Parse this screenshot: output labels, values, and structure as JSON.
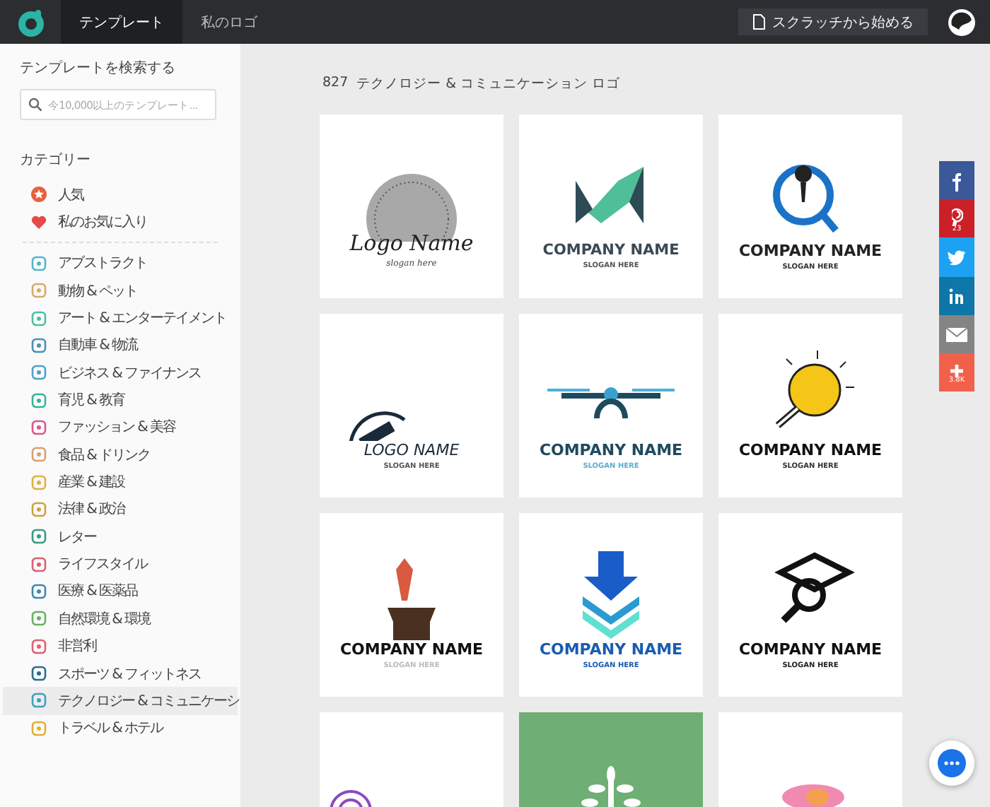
{
  "topbar": {
    "tabs": [
      {
        "label": "テンプレート",
        "selected": true
      },
      {
        "label": "私のロゴ",
        "selected": false
      }
    ],
    "start_button": "スクラッチから始める"
  },
  "sidebar": {
    "search_title": "テンプレートを検索する",
    "search": {
      "placeholder": "今10,000以上のテンプレート..."
    },
    "category_title": "カテゴリー",
    "pinned": [
      {
        "label": "人気",
        "kind": "star",
        "color": "#e8603c"
      },
      {
        "label": "私のお気に入り",
        "kind": "heart",
        "color": "#e84848"
      }
    ],
    "items": [
      {
        "label": "アブストラクト",
        "color": "#4fb8c9",
        "selected": false
      },
      {
        "label": "動物 & ペット",
        "color": "#d9a96a",
        "selected": false
      },
      {
        "label": "アート & エンターテイメント",
        "color": "#4fbfa0",
        "selected": false
      },
      {
        "label": "自動車 & 物流",
        "color": "#4a90b8",
        "selected": false
      },
      {
        "label": "ビジネス & ファイナンス",
        "color": "#4fa0c9",
        "selected": false
      },
      {
        "label": "育児 & 教育",
        "color": "#3ab09a",
        "selected": false
      },
      {
        "label": "ファッション & 美容",
        "color": "#d9588a",
        "selected": false
      },
      {
        "label": "食品 & ドリンク",
        "color": "#d9a070",
        "selected": false
      },
      {
        "label": "産業 & 建設",
        "color": "#e0b040",
        "selected": false
      },
      {
        "label": "法律 & 政治",
        "color": "#d0a040",
        "selected": false
      },
      {
        "label": "レター",
        "color": "#3a9a80",
        "selected": false
      },
      {
        "label": "ライフスタイル",
        "color": "#d96070",
        "selected": false
      },
      {
        "label": "医療 & 医薬品",
        "color": "#3a8ab0",
        "selected": false
      },
      {
        "label": "自然環境 & 環境",
        "color": "#6ab060",
        "selected": false
      },
      {
        "label": "非営利",
        "color": "#e06070",
        "selected": false
      },
      {
        "label": "スポーツ & フィットネス",
        "color": "#2a6a90",
        "selected": false
      },
      {
        "label": "テクノロジー & コミュニケーシ",
        "color": "#3aa0c0",
        "selected": true
      },
      {
        "label": "トラベル & ホテル",
        "color": "#e0b030",
        "selected": false
      }
    ]
  },
  "main": {
    "count": "827",
    "heading": "テクノロジー & コミュニケーション ロゴ",
    "tiles": [
      {
        "kind": "stamp",
        "name": "Logo Name",
        "slogan": "slogan here"
      },
      {
        "kind": "fold",
        "name": "COMPANY NAME",
        "slogan": "SLOGAN HERE"
      },
      {
        "kind": "search-person",
        "name": "COMPANY NAME",
        "slogan": "SLOGAN HERE"
      },
      {
        "kind": "satellite",
        "name": "LOGO NAME",
        "slogan": "SLOGAN HERE"
      },
      {
        "kind": "drone",
        "name": "COMPANY NAME",
        "slogan": "SLOGAN HERE"
      },
      {
        "kind": "sun-lens",
        "name": "COMPANY NAME",
        "slogan": "SLOGAN HERE"
      },
      {
        "kind": "rocket-box",
        "name": "COMPANY NAME",
        "slogan": "SLOGAN HERE"
      },
      {
        "kind": "arrow",
        "name": "COMPANY NAME",
        "slogan": "SLOGAN HERE"
      },
      {
        "kind": "cap-lens",
        "name": "COMPANY NAME",
        "slogan": "SLOGAN HERE"
      },
      {
        "kind": "rings"
      },
      {
        "kind": "tree"
      },
      {
        "kind": "eye"
      }
    ]
  },
  "share": [
    {
      "kind": "facebook"
    },
    {
      "kind": "pinterest",
      "count": "23"
    },
    {
      "kind": "twitter"
    },
    {
      "kind": "linkedin"
    },
    {
      "kind": "email"
    },
    {
      "kind": "more",
      "count": "3.8K"
    }
  ]
}
